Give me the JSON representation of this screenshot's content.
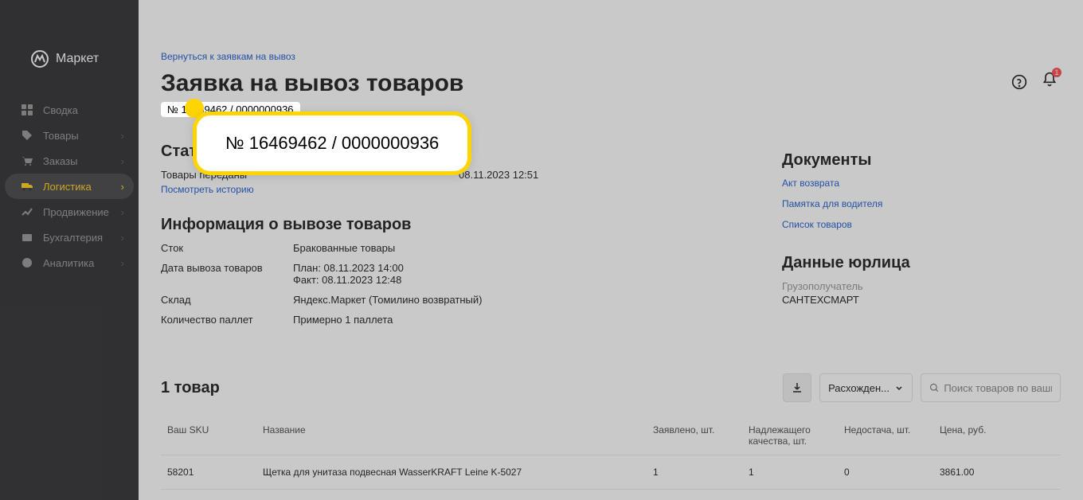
{
  "brand": "Маркет",
  "sidebar": {
    "items": [
      {
        "label": "Сводка"
      },
      {
        "label": "Товары"
      },
      {
        "label": "Заказы"
      },
      {
        "label": "Логистика"
      },
      {
        "label": "Продвижение"
      },
      {
        "label": "Бухгалтерия"
      },
      {
        "label": "Аналитика"
      }
    ]
  },
  "header": {
    "back_link": "Вернуться к заявкам на вывоз",
    "title": "Заявка на вывоз товаров",
    "number": "№ 16469462 / 0000000936",
    "highlight_number": "№ 16469462 / 0000000936",
    "notifications_count": "1"
  },
  "status": {
    "title": "Статус",
    "text": "Товары переданы",
    "datetime": "08.11.2023 12:51",
    "history_link": "Посмотреть историю"
  },
  "info": {
    "title": "Информация о вывозе товаров",
    "rows": {
      "stock_label": "Сток",
      "stock_value": "Бракованные товары",
      "date_label": "Дата вывоза товаров",
      "date_plan": "План: 08.11.2023 14:00",
      "date_fact": "Факт: 08.11.2023 12:48",
      "warehouse_label": "Склад",
      "warehouse_value": "Яндекс.Маркет (Томилино возвратный)",
      "pallets_label": "Количество паллет",
      "pallets_value": "Примерно 1 паллета"
    }
  },
  "documents": {
    "title": "Документы",
    "links": [
      "Акт возврата",
      "Памятка для водителя",
      "Список товаров"
    ]
  },
  "legal": {
    "title": "Данные юрлица",
    "label": "Грузополучатель",
    "value": "САНТЕХСМАРТ"
  },
  "products": {
    "title": "1 товар",
    "filter_label": "Расхожден...",
    "search_placeholder": "Поиск товаров по вашим SKU",
    "columns": {
      "sku": "Ваш SKU",
      "name": "Название",
      "declared": "Заявлено, шт.",
      "quality": "Надлежащего качества, шт.",
      "shortage": "Недостача, шт.",
      "price": "Цена, руб."
    },
    "row": {
      "sku": "58201",
      "name": "Щетка для унитаза подвесная WasserKRAFT Leine K-5027",
      "declared": "1",
      "quality": "1",
      "shortage": "0",
      "price": "3861.00"
    }
  }
}
